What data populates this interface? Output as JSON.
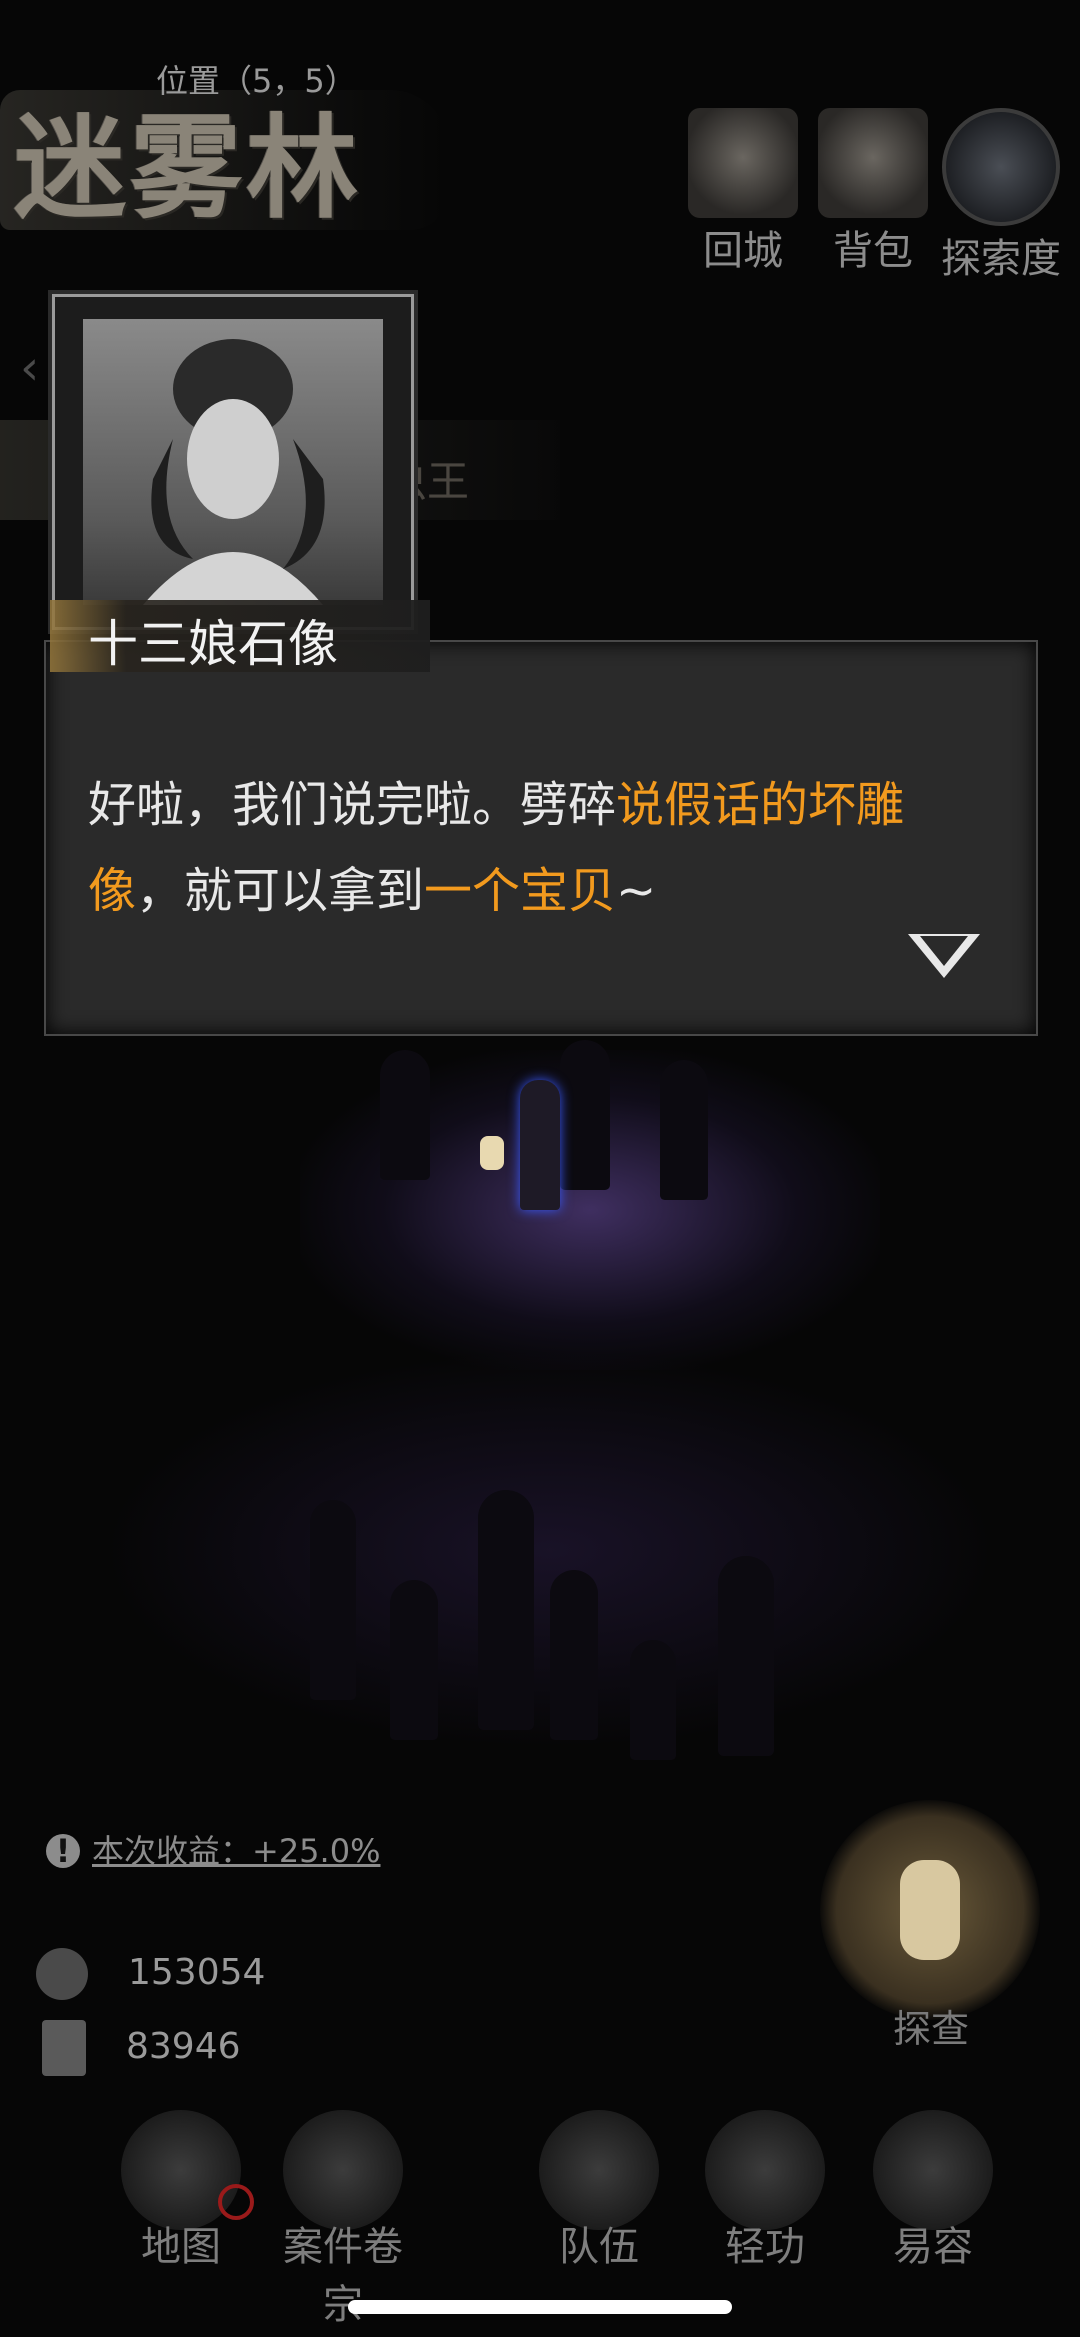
{
  "header": {
    "title": "迷雾林",
    "location": "位置（5，5）",
    "buttons": [
      {
        "label": "回城",
        "icon": "city-gate-icon"
      },
      {
        "label": "背包",
        "icon": "bag-icon"
      },
      {
        "label": "探索度",
        "icon": "explore-progress-icon"
      }
    ]
  },
  "background_banner": "虫王",
  "npc": {
    "name": "十三娘石像",
    "portrait_icon": "statue-portrait"
  },
  "dialog": {
    "seg1": "好啦，我们说完啦。劈碎",
    "seg2_highlight": "说假话的坏雕像",
    "seg3": "，就可以拿到",
    "seg4_highlight": "一个宝贝",
    "seg5": "~",
    "highlight_color": "#f29a1e"
  },
  "income": {
    "text": "本次收益：+25.0%"
  },
  "resources": {
    "coins": "153054",
    "scrolls": "83946"
  },
  "investigate": {
    "label": "探查"
  },
  "nav": [
    {
      "label": "地图",
      "icon": "map-icon"
    },
    {
      "label": "案件卷宗",
      "icon": "case-file-icon"
    },
    {
      "label": "队伍",
      "icon": "team-icon"
    },
    {
      "label": "轻功",
      "icon": "qinggong-boots-icon"
    },
    {
      "label": "易容",
      "icon": "disguise-mask-icon"
    }
  ]
}
